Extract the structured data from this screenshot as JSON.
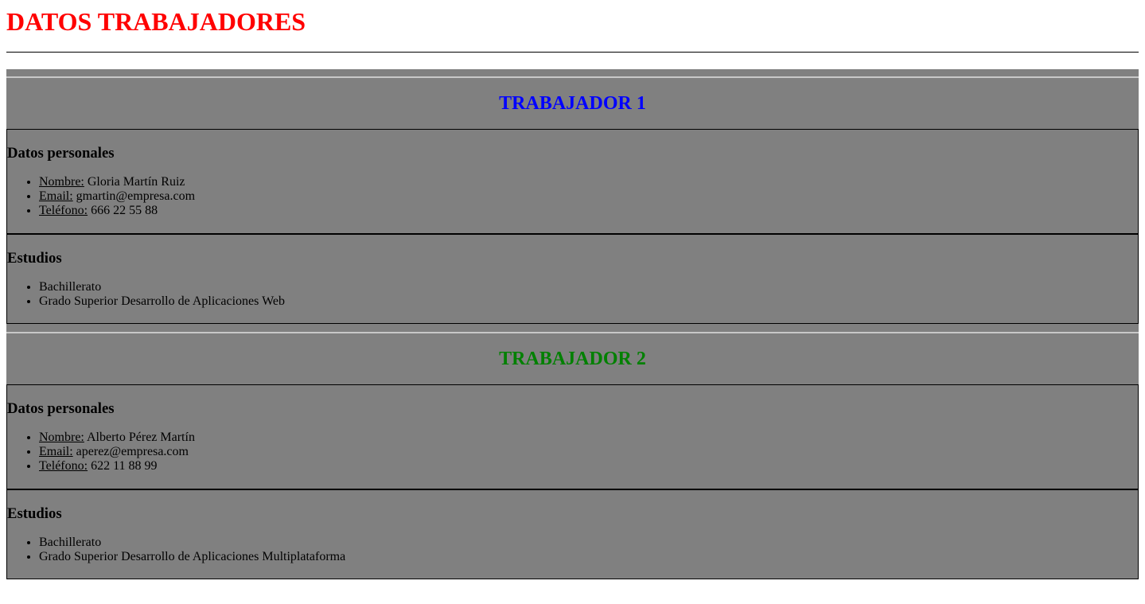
{
  "page": {
    "title": "DATOS TRABAJADORES"
  },
  "colors": {
    "title": "#ff0000",
    "worker1_heading": "#0000ff",
    "worker2_heading": "#008000",
    "panel_background": "#808080"
  },
  "workers": [
    {
      "heading": "TRABAJADOR 1",
      "personal_title": "Datos personales",
      "personal": [
        {
          "label": "Nombre:",
          "value": " Gloria Martín Ruiz"
        },
        {
          "label": "Email:",
          "value": " gmartin@empresa.com"
        },
        {
          "label": "Teléfono:",
          "value": " 666 22 55 88"
        }
      ],
      "studies_title": "Estudios",
      "studies": [
        "Bachillerato",
        "Grado Superior Desarrollo de Aplicaciones Web"
      ]
    },
    {
      "heading": "TRABAJADOR 2",
      "personal_title": "Datos personales",
      "personal": [
        {
          "label": "Nombre:",
          "value": " Alberto Pérez Martín"
        },
        {
          "label": "Email:",
          "value": " aperez@empresa.com"
        },
        {
          "label": "Teléfono:",
          "value": " 622 11 88 99"
        }
      ],
      "studies_title": "Estudios",
      "studies": [
        "Bachillerato",
        "Grado Superior Desarrollo de Aplicaciones Multiplataforma"
      ]
    }
  ]
}
